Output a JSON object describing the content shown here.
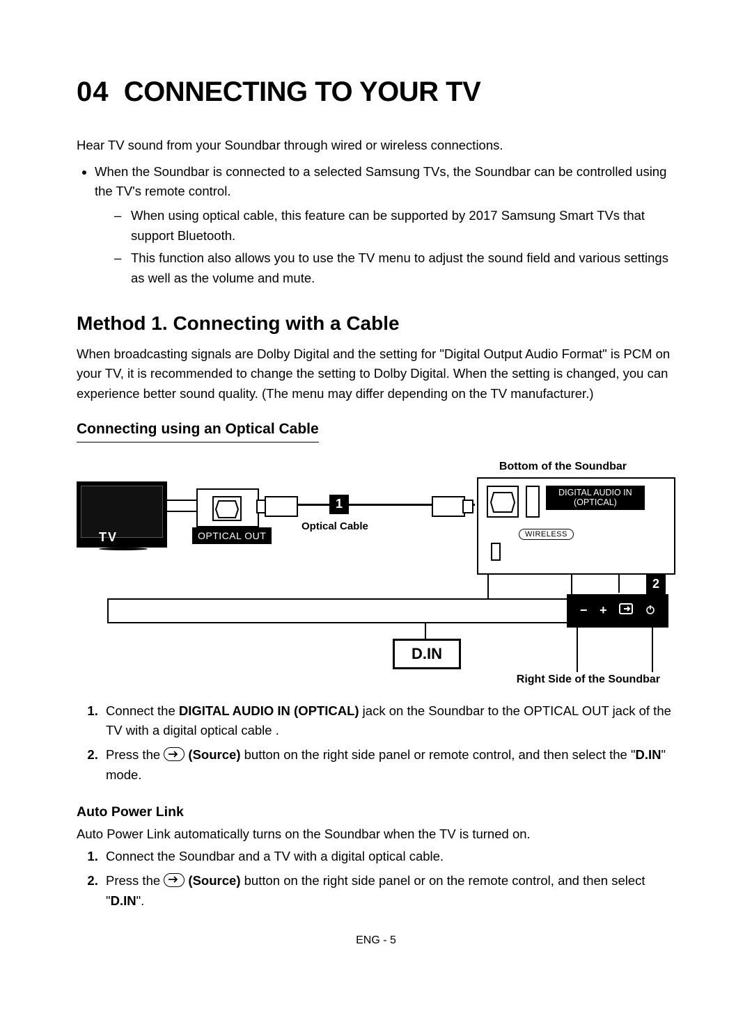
{
  "chapter_number": "04",
  "chapter_title": "CONNECTING TO YOUR TV",
  "intro": "Hear TV sound from your Soundbar through wired or wireless connections.",
  "bullet_main": "When the Soundbar is connected to a selected Samsung TVs, the Soundbar can be controlled using the TV's remote control.",
  "dash1": "When using optical cable, this feature can be supported by 2017 Samsung Smart TVs that support Bluetooth.",
  "dash2": "This function also allows you to use the TV menu to adjust the sound field and various settings as well as the volume and mute.",
  "method1_heading": "Method 1. Connecting with a Cable",
  "method1_body": "When broadcasting signals are Dolby Digital and the setting for \"Digital Output Audio Format\" is PCM on your TV, it is recommended to change the setting to Dolby Digital. When the setting is changed, you can experience better sound quality. (The menu may differ depending on the TV manufacturer.)",
  "sub_heading": "Connecting using an Optical Cable",
  "diagram": {
    "caption_top": "Bottom of the Soundbar",
    "tv_label": "TV",
    "optical_out": "OPTICAL OUT",
    "optical_cable": "Optical Cable",
    "digital_audio_in": "DIGITAL AUDIO IN (OPTICAL)",
    "wireless": "WIRELESS",
    "step1": "1",
    "step2": "2",
    "din": "D.IN",
    "caption_bottom": "Right Side of the Soundbar"
  },
  "steps_main": {
    "s1_a": "Connect the ",
    "s1_b": "DIGITAL AUDIO IN (OPTICAL)",
    "s1_c": " jack on the Soundbar to the OPTICAL OUT jack of the TV with a digital optical cable .",
    "s2_a": "Press the ",
    "s2_b": " (Source)",
    "s2_c": " button on the right side panel or remote control, and then select the \"",
    "s2_d": "D.IN",
    "s2_e": "\" mode."
  },
  "autopower_heading": "Auto Power Link",
  "autopower_intro": "Auto Power Link automatically turns on the Soundbar when the TV is turned on.",
  "autopower_steps": {
    "s1": "Connect the Soundbar and a TV with a digital optical cable.",
    "s2_a": "Press the ",
    "s2_b": " (Source)",
    "s2_c": " button on the right side panel or on the remote control, and then select \"",
    "s2_d": "D.IN",
    "s2_e": "\"."
  },
  "footer": "ENG - 5"
}
